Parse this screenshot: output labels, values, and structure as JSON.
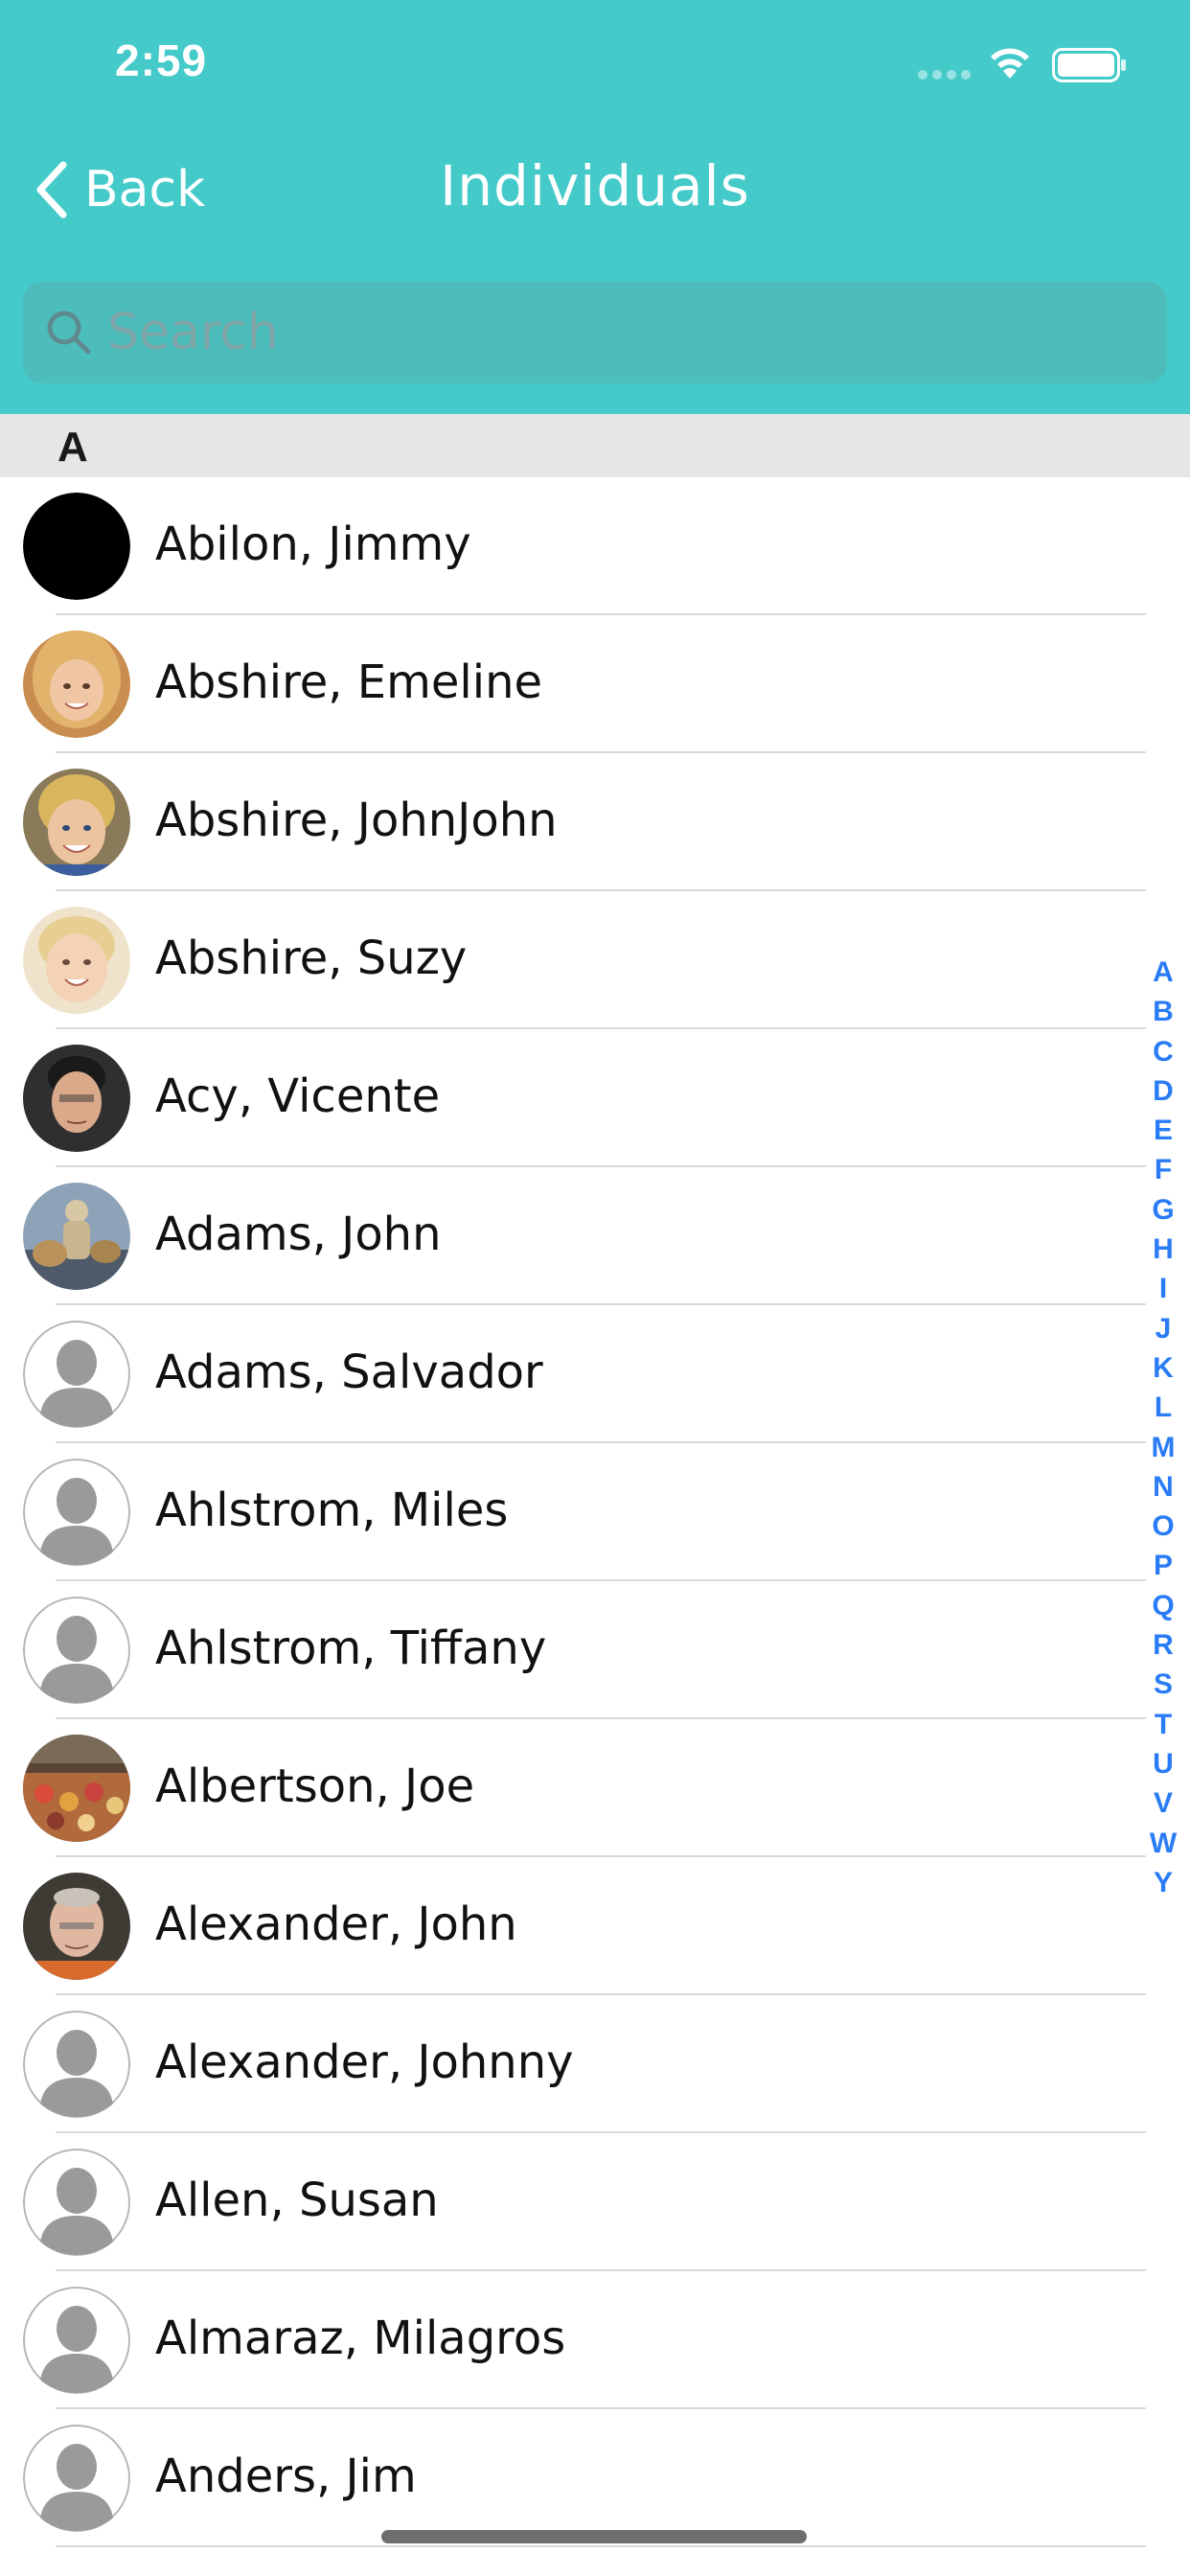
{
  "status_bar": {
    "time": "2:59"
  },
  "nav": {
    "back_label": "Back",
    "title": "Individuals"
  },
  "search": {
    "placeholder": "Search",
    "value": ""
  },
  "section": {
    "letter": "A"
  },
  "contacts": [
    {
      "name": "Abilon, Jimmy",
      "avatar": "black-circle"
    },
    {
      "name": "Abshire, Emeline",
      "avatar": "photo-blonde-girl"
    },
    {
      "name": "Abshire, JohnJohn",
      "avatar": "photo-blonde-boy"
    },
    {
      "name": "Abshire, Suzy",
      "avatar": "photo-blonde-toddler"
    },
    {
      "name": "Acy, Vicente",
      "avatar": "photo-man-dark-hair"
    },
    {
      "name": "Adams, John",
      "avatar": "photo-figurine"
    },
    {
      "name": "Adams, Salvador",
      "avatar": "placeholder-person"
    },
    {
      "name": "Ahlstrom, Miles",
      "avatar": "placeholder-person"
    },
    {
      "name": "Ahlstrom, Tiffany",
      "avatar": "placeholder-person"
    },
    {
      "name": "Albertson, Joe",
      "avatar": "photo-market"
    },
    {
      "name": "Alexander, John",
      "avatar": "photo-older-man"
    },
    {
      "name": "Alexander, Johnny",
      "avatar": "placeholder-person"
    },
    {
      "name": "Allen, Susan",
      "avatar": "placeholder-person"
    },
    {
      "name": "Almaraz, Milagros",
      "avatar": "placeholder-person"
    },
    {
      "name": "Anders, Jim",
      "avatar": "placeholder-person"
    }
  ],
  "index_letters": [
    "A",
    "B",
    "C",
    "D",
    "E",
    "F",
    "G",
    "H",
    "I",
    "J",
    "K",
    "L",
    "M",
    "N",
    "O",
    "P",
    "Q",
    "R",
    "S",
    "T",
    "U",
    "V",
    "W",
    "Y"
  ],
  "colors": {
    "header": "#45CACA",
    "search_field": "#4DBDBB",
    "section_header": "#E6E6E6",
    "index_accent": "#2A7CF6",
    "divider": "#D7D7D7"
  },
  "icons": {
    "back": "chevron-left-icon",
    "search": "search-icon",
    "wifi": "wifi-icon",
    "battery": "battery-icon",
    "signal": "cellular-signal-icon"
  }
}
